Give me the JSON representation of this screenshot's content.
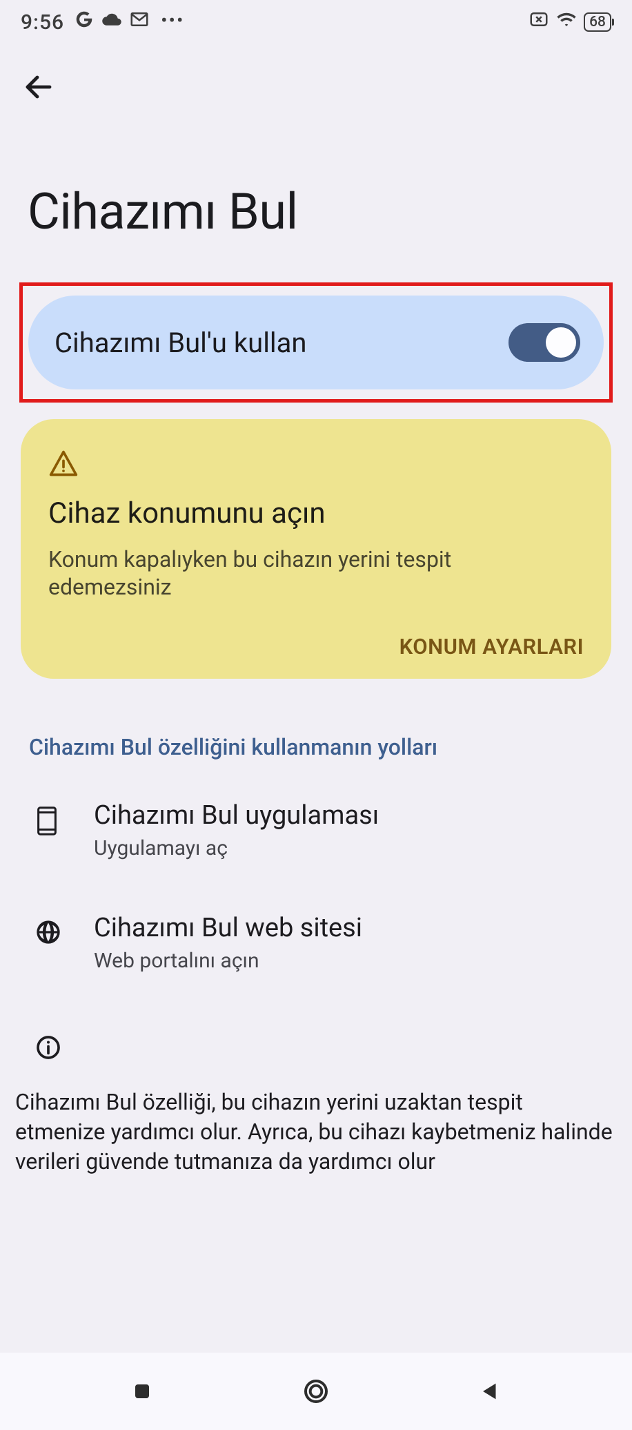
{
  "status": {
    "time": "9:56",
    "battery": "68"
  },
  "page": {
    "title": "Cihazımı Bul"
  },
  "toggle": {
    "label": "Cihazımı Bul'u kullan",
    "on": true
  },
  "warning": {
    "title": "Cihaz konumunu açın",
    "body": "Konum kapalıyken bu cihazın yerini tespit edemezsiniz",
    "action": "KONUM AYARLARI"
  },
  "section": {
    "heading": "Cihazımı Bul özelliğini kullanmanın yolları"
  },
  "ways": [
    {
      "title": "Cihazımı Bul uygulaması",
      "sub": "Uygulamayı aç"
    },
    {
      "title": "Cihazımı Bul web sitesi",
      "sub": "Web portalını açın"
    }
  ],
  "footer": {
    "text": "Cihazımı Bul özelliği, bu cihazın yerini uzaktan tespit etmenize yardımcı olur. Ayrıca, bu cihazı kaybetmeniz halinde verileri güvende tutmanıza da yardımcı olur"
  }
}
